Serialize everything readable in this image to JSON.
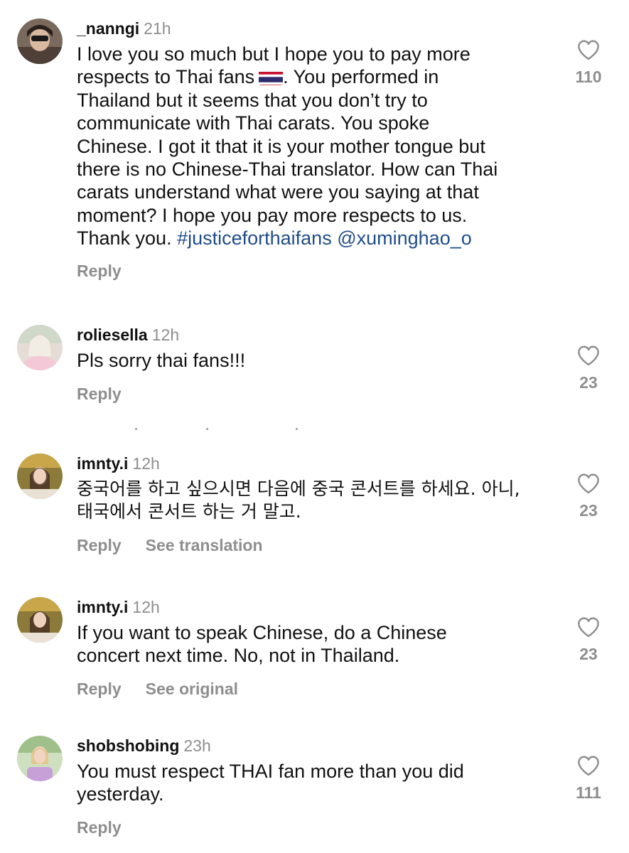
{
  "comments": [
    {
      "username": "_nanngi",
      "time": "21h",
      "text_before_flag": "I love you so much but I hope you to pay more\nrespects to Thai fans",
      "flag_icon": "thailand-flag-icon",
      "text_after_flag": ". You performed in\nThailand but  it seems that you don’t try to\ncommunicate with Thai carats. You spoke\nChinese. I got it that it is your mother tongue but\nthere is no Chinese-Thai translator. How can Thai\ncarats understand what were you saying at that\nmoment?  I hope you pay more respects to us.\nThank you. ",
      "hashtag": "#justiceforthaifans",
      "mention": "@xuminghao_o",
      "reply_label": "Reply",
      "likes": "110"
    },
    {
      "username": "roliesella",
      "time": "12h",
      "text": "Pls sorry thai fans!!!",
      "reply_label": "Reply",
      "likes": "23"
    },
    {
      "username": "imnty.i",
      "time": "12h",
      "text": "중국어를 하고 싶으시면 다음에 중국 콘서트를 하세요. 아니,\n태국에서 콘서트 하는 거 말고.",
      "reply_label": "Reply",
      "secondary_label": "See translation",
      "likes": "23"
    },
    {
      "username": "imnty.i",
      "time": "12h",
      "text": "If you want to speak Chinese, do a Chinese\nconcert next time. No, not in Thailand.",
      "reply_label": "Reply",
      "secondary_label": "See original",
      "likes": "23"
    },
    {
      "username": "shobshobing",
      "time": "23h",
      "text": "You must respect THAI fan more than you did\nyesterday.",
      "reply_label": "Reply",
      "likes": "111"
    }
  ],
  "colors": {
    "text": "#111111",
    "secondary": "#8e8e8e",
    "link": "#1f4d8a",
    "background": "#ffffff"
  }
}
